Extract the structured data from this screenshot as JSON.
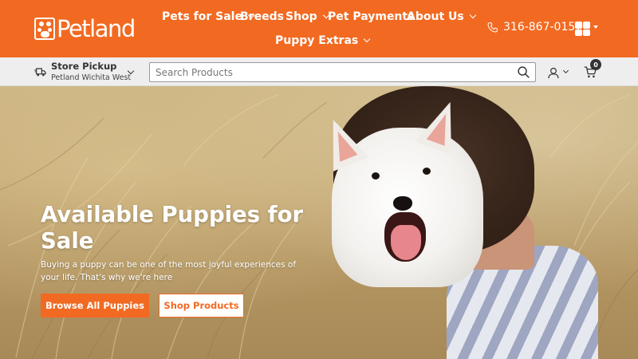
{
  "brand": {
    "logo_text": "Petland",
    "accent_color": "#f26a22"
  },
  "nav": {
    "items": [
      {
        "label": "Pets for Sale",
        "has_dropdown": true
      },
      {
        "label": "Breeds",
        "has_dropdown": false
      },
      {
        "label": "Shop",
        "has_dropdown": true
      },
      {
        "label": "Pet Payments",
        "has_dropdown": false
      },
      {
        "label": "About Us",
        "has_dropdown": true
      },
      {
        "label": "Puppy Extras",
        "has_dropdown": true
      }
    ]
  },
  "contact": {
    "phone": "316-867-0157",
    "phone_icon": "phone-icon",
    "social_icon": "social-media-icon"
  },
  "store_pickup": {
    "title": "Store Pickup",
    "store": "Petland Wichita West",
    "icon": "delivery-icon"
  },
  "search": {
    "placeholder": "Search Products",
    "icon": "search-icon"
  },
  "account": {
    "icon": "user-icon"
  },
  "cart": {
    "icon": "cart-icon",
    "count": "0"
  },
  "hero": {
    "title": "Available Puppies for Sale",
    "subtitle": "Buying a puppy can be one of the most joyful experiences of your life. That's why we're here",
    "primary_button": "Browse All Puppies",
    "secondary_button": "Shop Products"
  }
}
